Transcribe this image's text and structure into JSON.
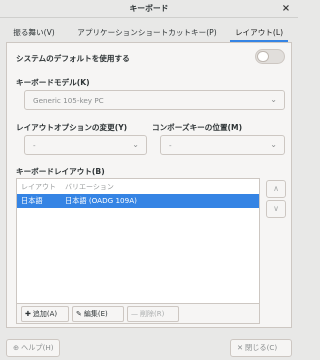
{
  "window": {
    "title": "キーボード",
    "close_glyph": "×"
  },
  "tabs": [
    {
      "label": "振る舞い(V)",
      "active": false
    },
    {
      "label": "アプリケーションショートカットキー(P)",
      "active": false
    },
    {
      "label": "レイアウト(L)",
      "active": true
    }
  ],
  "layout_tab": {
    "use_system_default_label": "システムのデフォルトを使用する",
    "use_system_default_on": false,
    "keyboard_model_label": "キーボードモデル(K)",
    "keyboard_model_value": "Generic 105-key PC",
    "layout_option_label": "レイアウトオプションの変更(Y)",
    "layout_option_value": "-",
    "compose_key_label": "コンポーズキーの位置(M)",
    "compose_key_value": "-",
    "keyboard_layout_label": "キーボードレイアウト(B)",
    "list_columns": [
      "レイアウト",
      "バリエーション"
    ],
    "list_rows": [
      {
        "layout": "日本語",
        "variation": "日本語 (OADG 109A)",
        "selected": true
      }
    ],
    "toolbar": {
      "add_label": "追加(A)",
      "edit_label": "編集(E)",
      "delete_label": "削除(R)"
    },
    "move_up_glyph": "∧",
    "move_down_glyph": "∨"
  },
  "footer": {
    "help_label": "ヘルプ(H)",
    "close_label": "閉じる(C)"
  },
  "colors": {
    "accent": "#3584e4",
    "background": "#e8e8e7",
    "panel": "#f6f5f4"
  },
  "icons": [
    "close-icon",
    "chevron-down-icon",
    "plus-icon",
    "pencil-icon",
    "minus-icon",
    "chevron-up-icon",
    "help-icon"
  ]
}
